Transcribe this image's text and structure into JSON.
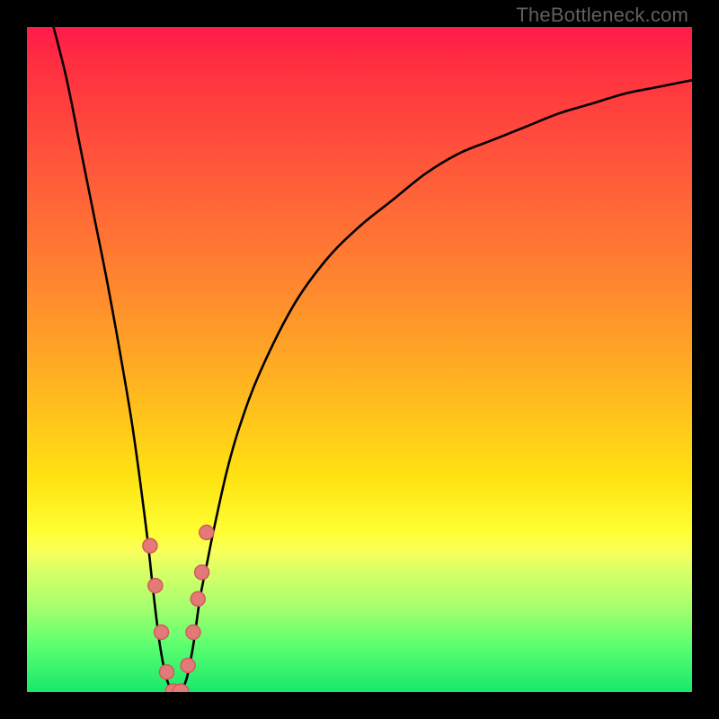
{
  "watermark": "TheBottleneck.com",
  "chart_data": {
    "type": "line",
    "title": "",
    "xlabel": "",
    "ylabel": "",
    "xlim": [
      0,
      100
    ],
    "ylim": [
      0,
      100
    ],
    "series": [
      {
        "name": "curve",
        "x": [
          4,
          6,
          8,
          10,
          12,
          14,
          16,
          18,
          19,
          20,
          21,
          22,
          23,
          24,
          25,
          26,
          27,
          28,
          30,
          32,
          35,
          40,
          45,
          50,
          55,
          60,
          65,
          70,
          75,
          80,
          85,
          90,
          95,
          100
        ],
        "values": [
          100,
          92,
          82,
          72,
          62,
          51,
          39,
          24,
          15,
          7,
          2,
          0,
          0,
          2,
          7,
          14,
          19,
          24,
          33,
          40,
          48,
          58,
          65,
          70,
          74,
          78,
          81,
          83,
          85,
          87,
          88.5,
          90,
          91,
          92
        ]
      }
    ],
    "points": {
      "name": "markers",
      "x": [
        18.5,
        19.3,
        20.2,
        21.0,
        22.0,
        23.1,
        24.2,
        25.0,
        25.7,
        26.3,
        27.0
      ],
      "values": [
        22,
        16,
        9,
        3,
        0,
        0,
        4,
        9,
        14,
        18,
        24
      ]
    }
  },
  "colors": {
    "curve_stroke": "#000000",
    "dot_fill": "#e37a78",
    "dot_stroke": "#cf5c59"
  }
}
